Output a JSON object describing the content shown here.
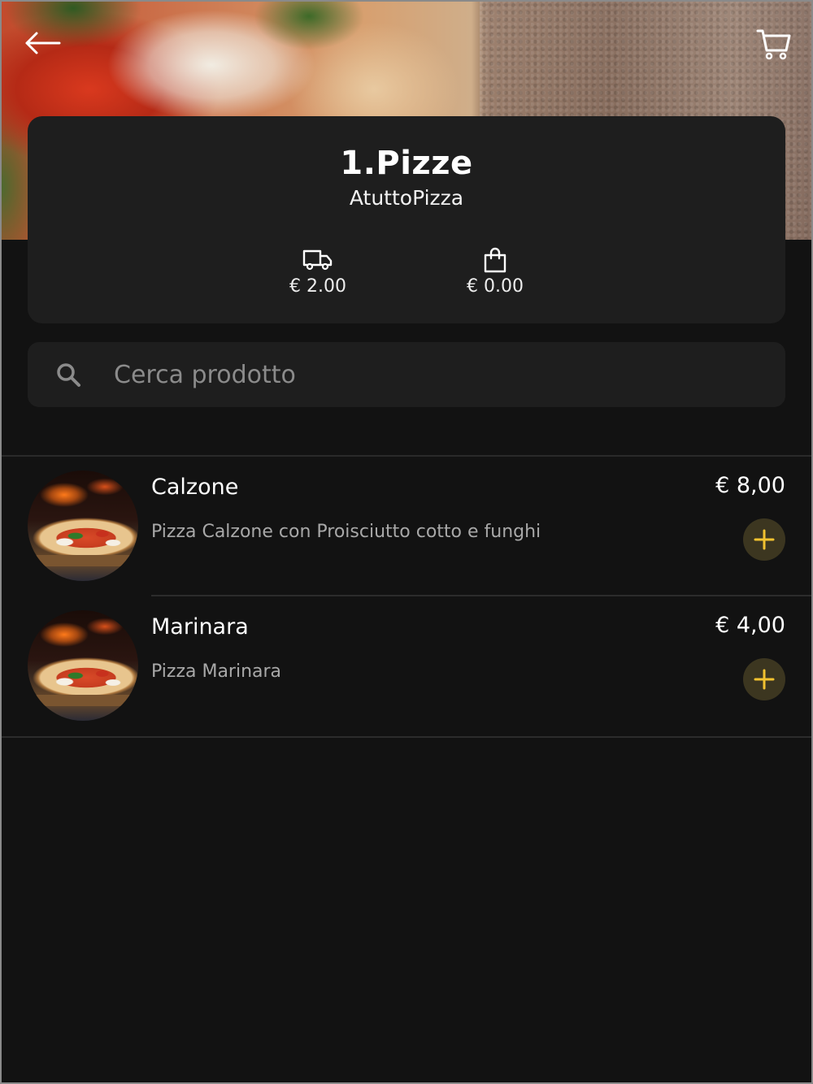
{
  "header": {
    "back_icon": "arrow-left-icon",
    "cart_icon": "cart-icon"
  },
  "category": {
    "title": "1.Pizze",
    "restaurant": "AtuttoPizza",
    "delivery_fee": "€ 2.00",
    "delivery_icon": "truck-icon",
    "order_total": "€ 0.00",
    "order_icon": "shopping-bag-icon"
  },
  "search": {
    "placeholder": "Cerca prodotto",
    "value": "",
    "icon": "search-icon"
  },
  "products": [
    {
      "name": "Calzone",
      "description": "Pizza Calzone con Proisciutto cotto e funghi",
      "price": "€ 8,00",
      "add_icon": "plus-icon"
    },
    {
      "name": "Marinara",
      "description": "Pizza Marinara",
      "price": "€ 4,00",
      "add_icon": "plus-icon"
    }
  ],
  "colors": {
    "background": "#121212",
    "card": "#1e1e1e",
    "accent": "#f2c230",
    "add_button_bg": "#3c3620",
    "muted_text": "#a8a8a8"
  }
}
